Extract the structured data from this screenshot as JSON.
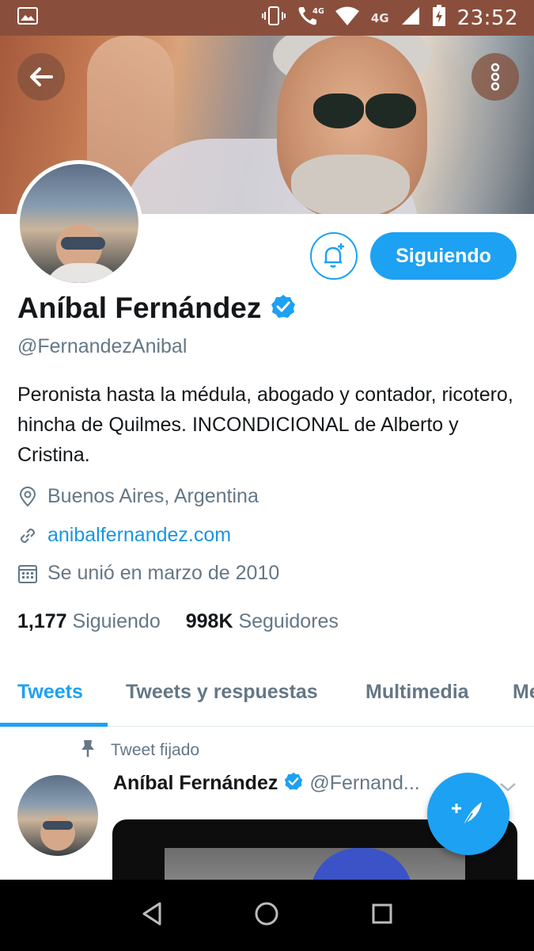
{
  "status_bar": {
    "time": "23:52",
    "network_label": "4G",
    "icons": [
      "image-icon",
      "vibrate-icon",
      "wifi-call-icon",
      "wifi-icon",
      "signal-icon",
      "battery-icon"
    ]
  },
  "profile": {
    "name": "Aníbal Fernández",
    "handle": "@FernandezAnibal",
    "verified": true,
    "bio": "Peronista hasta la médula, abogado y contador, ricotero, hincha de Quilmes. INCONDICIONAL de Alberto y Cristina.",
    "location": "Buenos Aires, Argentina",
    "website": "anibalfernandez.com",
    "joined": "Se unió en marzo de 2010",
    "following_count": "1,177",
    "following_label": "Siguiendo",
    "followers_count": "998K",
    "followers_label": "Seguidores",
    "follow_button_label": "Siguiendo"
  },
  "tabs": [
    {
      "label": "Tweets",
      "active": true
    },
    {
      "label": "Tweets y respuestas",
      "active": false
    },
    {
      "label": "Multimedia",
      "active": false
    },
    {
      "label": "Me",
      "active": false
    }
  ],
  "pinned_tweet": {
    "pinned_label": "Tweet fijado",
    "author_name": "Aníbal Fernández",
    "author_handle": "@Fernand..."
  },
  "colors": {
    "accent": "#1da1f2",
    "link": "#1b95e0",
    "secondary_text": "#657786",
    "status_bar": "#8a4f3c"
  }
}
